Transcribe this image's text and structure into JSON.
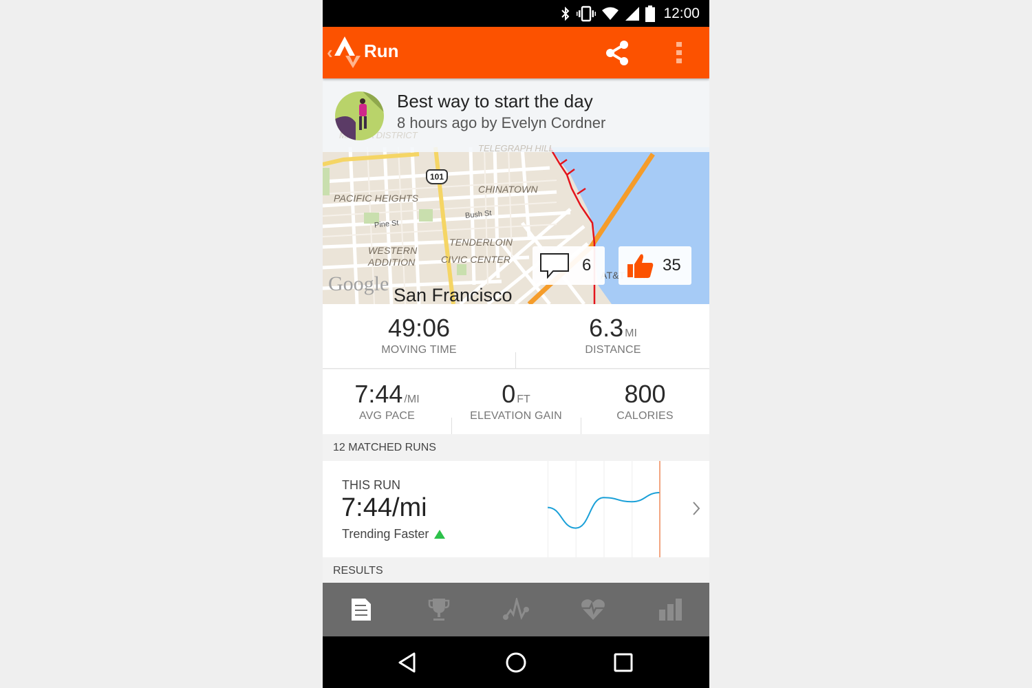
{
  "status_bar": {
    "time": "12:00",
    "icons": [
      "bluetooth-icon",
      "vibrate-icon",
      "wifi-icon",
      "cell-signal-icon",
      "battery-icon"
    ]
  },
  "app_bar": {
    "title": "Run",
    "back_glyph": "‹",
    "actions": [
      "share-icon",
      "more-vert-icon"
    ]
  },
  "activity": {
    "title": "Best way to start the day",
    "subtitle": "8 hours ago by Evelyn Cordner"
  },
  "map": {
    "city": "San Francisco",
    "attribution": "Google",
    "highway_shield": "101",
    "neighborhoods": [
      "PACIFIC HEIGHTS",
      "CHINATOWN",
      "TENDERLOIN",
      "WESTERN",
      "ADDITION",
      "CIVIC CENTER",
      "TELEGRAPH HILL",
      "MARINA DISTRICT",
      "AT&T Park"
    ],
    "streets": [
      "Pine St",
      "Bush St"
    ],
    "colors": {
      "route": "#e3141c",
      "water": "#a6cbf6",
      "highway": "#f59c2a",
      "land": "#ebe4d8"
    }
  },
  "social": {
    "comments_count": "6",
    "kudos_count": "35",
    "kudos_color": "#fc5200"
  },
  "stats": {
    "moving_time": {
      "value": "49:06",
      "unit": "",
      "label": "MOVING TIME"
    },
    "distance": {
      "value": "6.3",
      "unit": "MI",
      "label": "DISTANCE"
    },
    "avg_pace": {
      "value": "7:44",
      "unit": "/MI",
      "label": "AVG PACE"
    },
    "elevation_gain": {
      "value": "0",
      "unit": "FT",
      "label": "ELEVATION GAIN"
    },
    "calories": {
      "value": "800",
      "unit": "",
      "label": "CALORIES"
    }
  },
  "matched_runs": {
    "header": "12 MATCHED RUNS",
    "this_run_label": "THIS RUN",
    "pace": "7:44/mi",
    "trend": "Trending Faster",
    "trend_color": "#2cc14a",
    "sparkline": {
      "line_color": "#1aa0d8",
      "marker_color": "#f08a5a",
      "relative_speed": [
        0.52,
        0.27,
        0.64,
        0.59,
        0.7
      ]
    }
  },
  "results": {
    "header": "RESULTS"
  },
  "tabs": [
    {
      "name": "overview",
      "icon": "document-icon",
      "active": true
    },
    {
      "name": "achievements",
      "icon": "trophy-icon",
      "active": false
    },
    {
      "name": "analysis",
      "icon": "pulse-line-icon",
      "active": false
    },
    {
      "name": "heart-rate",
      "icon": "heart-rate-icon",
      "active": false
    },
    {
      "name": "splits",
      "icon": "bar-chart-icon",
      "active": false
    }
  ],
  "nav_bar": [
    "back-icon",
    "home-icon",
    "recents-icon"
  ]
}
